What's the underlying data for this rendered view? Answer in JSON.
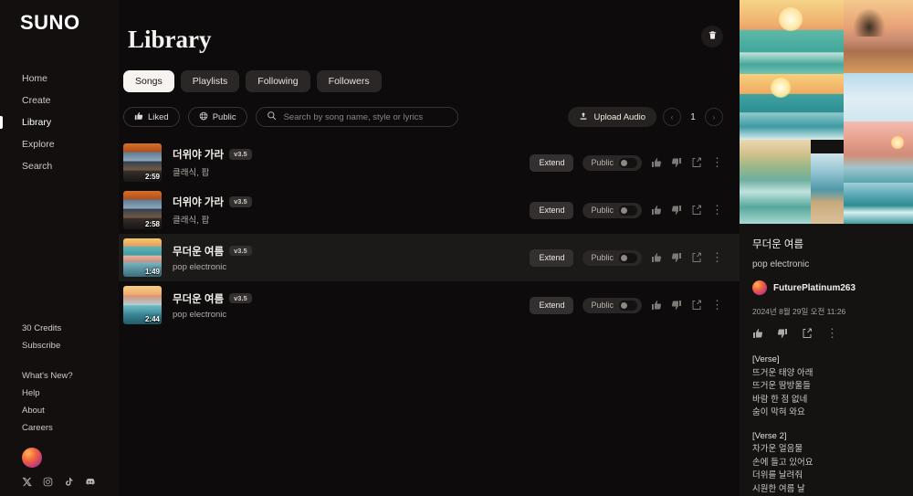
{
  "brand": "SUNO",
  "sidebar": {
    "nav": [
      {
        "label": "Home",
        "active": false
      },
      {
        "label": "Create",
        "active": false
      },
      {
        "label": "Library",
        "active": true
      },
      {
        "label": "Explore",
        "active": false
      },
      {
        "label": "Search",
        "active": false
      }
    ],
    "credits": "30 Credits",
    "subscribe": "Subscribe",
    "links": [
      {
        "label": "What's New?"
      },
      {
        "label": "Help"
      },
      {
        "label": "About"
      },
      {
        "label": "Careers"
      }
    ],
    "socials": [
      "x-icon",
      "instagram-icon",
      "tiktok-icon",
      "discord-icon"
    ]
  },
  "main": {
    "title": "Library",
    "delete_icon": "trash-icon",
    "tabs": [
      {
        "label": "Songs",
        "active": true
      },
      {
        "label": "Playlists",
        "active": false
      },
      {
        "label": "Following",
        "active": false
      },
      {
        "label": "Followers",
        "active": false
      }
    ],
    "filters": {
      "liked_label": "Liked",
      "liked_icon": "thumbs-up-icon",
      "public_label": "Public",
      "public_icon": "globe-icon",
      "search_icon": "search-icon",
      "search_value": "",
      "search_placeholder": "Search by song name, style or lyrics"
    },
    "upload": {
      "label": "Upload Audio",
      "icon": "upload-icon"
    },
    "pager": {
      "prev": "‹",
      "page": "1",
      "next": "›"
    },
    "songs": [
      {
        "title": "더위야 가라",
        "version": "v3.5",
        "genre": "클래식, 팝",
        "duration": "2:59",
        "art": "thumb-autumn",
        "extend_label": "Extend",
        "visibility_label": "Public",
        "selected": false
      },
      {
        "title": "더위야 가라",
        "version": "v3.5",
        "genre": "클래식, 팝",
        "duration": "2:58",
        "art": "thumb-autumn",
        "extend_label": "Extend",
        "visibility_label": "Public",
        "selected": false
      },
      {
        "title": "무더운 여름",
        "version": "v3.5",
        "genre": "pop electronic",
        "duration": "1:49",
        "art": "thumb-beach1",
        "extend_label": "Extend",
        "visibility_label": "Public",
        "selected": true
      },
      {
        "title": "무더운 여름",
        "version": "v3.5",
        "genre": "pop electronic",
        "duration": "2:44",
        "art": "thumb-beach2",
        "extend_label": "Extend",
        "visibility_label": "Public",
        "selected": false
      }
    ]
  },
  "detail": {
    "cover_alt": "beach-sunset-collage",
    "title": "무더운 여름",
    "genre": "pop electronic",
    "username": "FuturePlatinum263",
    "date": "2024년 8월 29일 오전 11:26",
    "actions": [
      "thumbs-up-icon",
      "thumbs-down-icon",
      "share-icon",
      "more-icon"
    ],
    "lyrics": [
      "[Verse]",
      "뜨거운 태양 아래",
      "뜨거운 땀방울들",
      "바람 한 점 없네",
      "숨이 막혀 와요",
      "",
      "[Verse 2]",
      "차가운 얼음물",
      "손에 들고 있어요",
      "더위를 날려줘",
      "시원한 여름 날"
    ]
  },
  "colors": {
    "bg": "#0b0a0a",
    "sidebar_bg": "#120f0e",
    "panel_bg": "#151312",
    "row_selected": "#1c1a19",
    "accent_text": "#f4f1ee"
  }
}
